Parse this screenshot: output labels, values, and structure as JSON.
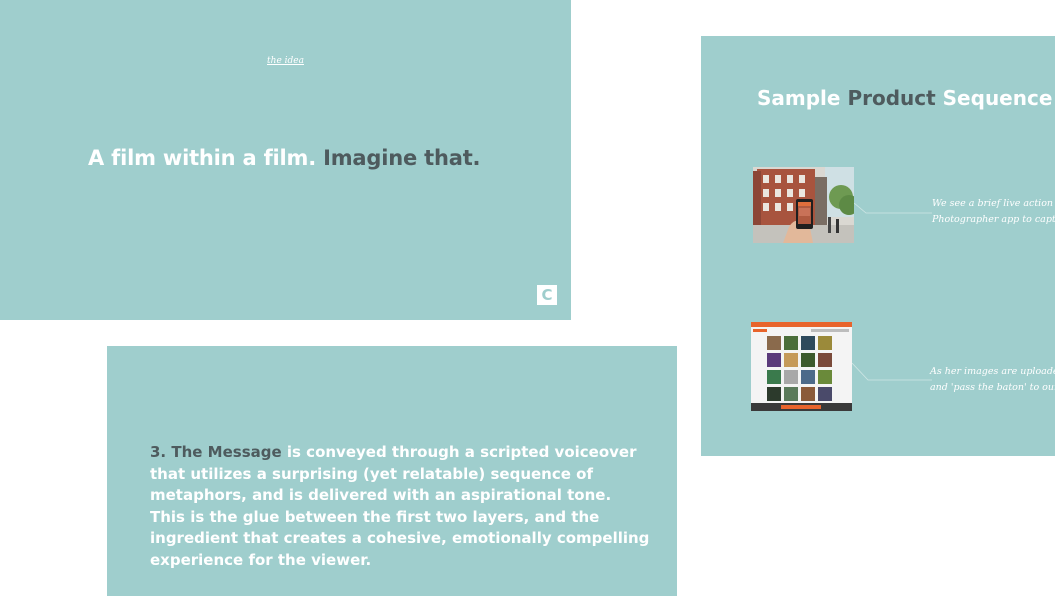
{
  "slides": {
    "idea": {
      "kicker": "the idea",
      "headline_part1": "A film within a film.",
      "headline_part2": "Imagine that.",
      "logo_letter": "C"
    },
    "message": {
      "number": "3.",
      "highlight": "The Message",
      "body": " is conveyed through a scripted voiceover that utilizes a surprising (yet relatable) sequence of metaphors, and is delivered with an aspirational tone. This is the glue between the first two layers, and the ingredient that creates a cohesive, emotionally compelling experience for the viewer."
    },
    "sequence": {
      "title_part1": "Sample",
      "title_part2": "Product",
      "title_part3": "Sequence",
      "items": [
        {
          "image": "street-photo-with-phone",
          "caption_line1": "We see a brief live action se",
          "caption_line2": "Photographer app to captu"
        },
        {
          "image": "photo-gallery-website",
          "caption_line1": "As her images are uploaded",
          "caption_line2": "and 'pass the baton' to our"
        }
      ]
    }
  },
  "colors": {
    "slide_bg": "#9fcecd",
    "text_light": "#ffffff",
    "text_dark": "#4e5b5e",
    "gallery_accent": "#e8642c"
  }
}
